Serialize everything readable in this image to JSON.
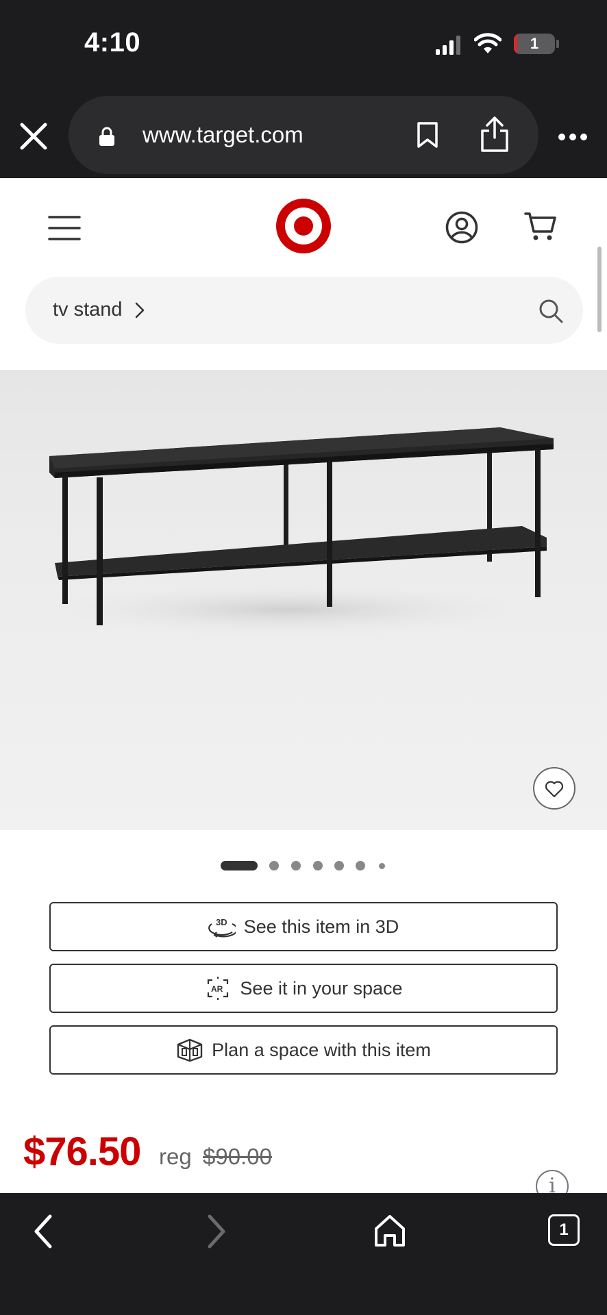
{
  "status_bar": {
    "time": "4:10",
    "battery_level": "1"
  },
  "browser": {
    "url": "www.target.com",
    "open_tabs": "1"
  },
  "header": {
    "brand": "Target"
  },
  "search": {
    "query": "tv stand"
  },
  "product": {
    "image_count": 7,
    "active_image_index": 1,
    "favorite": false
  },
  "actions": {
    "view_3d": "See this item in 3D",
    "view_ar": "See it in your space",
    "plan_space": "Plan a space with this item",
    "ar_badge": "AR",
    "badge_3d": "3D"
  },
  "price": {
    "current": "$76.50",
    "reg_label": "reg",
    "regular": "$90.00",
    "info_symbol": "i"
  },
  "colors": {
    "brand_red": "#cc0000",
    "browser_chrome": "#1c1c1e",
    "url_pill": "#2c2c2e"
  }
}
